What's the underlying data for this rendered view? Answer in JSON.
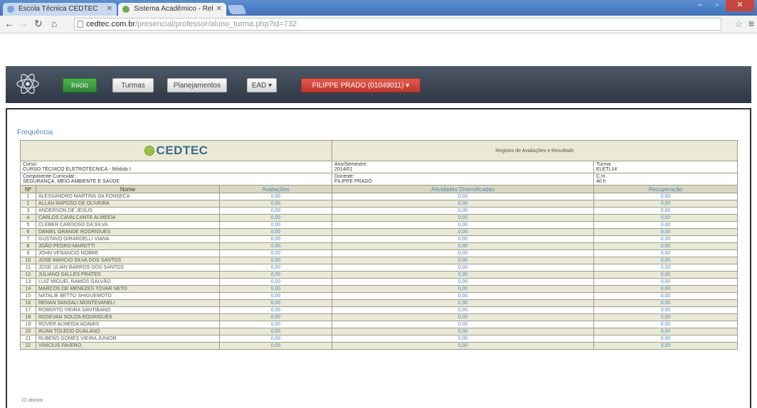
{
  "browser": {
    "tabs": [
      {
        "title": "Escola Técnica CEDTEC"
      },
      {
        "title": "Sistema Acadêmico - Rel"
      }
    ],
    "url_host": "cedtec.com.br",
    "url_path": "/presencial/professor/aluno_turma.php?id=732"
  },
  "nav": {
    "inicio": "Início",
    "turmas": "Turmas",
    "planejamento": "Planejamentos",
    "ead": "EAD ▾",
    "user": "FILIPPE PRADO (01049011) ▾"
  },
  "section_title": "Frequência",
  "report": {
    "logo_text": "CEDTEC",
    "title": "Registro de Avaliações e Resultado",
    "curso_label": "Curso:",
    "curso_value": "CURSO TÉCNICO ELETROTÉCNICA - Módulo I",
    "ano_label": "Ano/Semestre:",
    "ano_value": "2014/01",
    "turma_label": "Turma:",
    "turma_value": "ELETL14",
    "componente_label": "Componente Curricular:",
    "componente_value": "SEGURANÇA, MEIO AMBIENTE E SAÚDE",
    "docente_label": "Docente:",
    "docente_value": "FILIPPE PRADO",
    "ch_label": "C.H.",
    "ch_value": "40 h",
    "columns": [
      "Nº",
      "Nome",
      "Avaliações",
      "Atividades Diversificadas",
      "Recuperação"
    ],
    "students": [
      {
        "n": "1",
        "name": "ALESSANDRO MARTINS DA FONSECA",
        "av": "0,00",
        "ad": "0,00",
        "rec": "0,00"
      },
      {
        "n": "2",
        "name": "ALLAN RAPOSO DE OLIVEIRA",
        "av": "0,00",
        "ad": "0,00",
        "rec": "0,00"
      },
      {
        "n": "3",
        "name": "ANDERSON DE JESUS",
        "av": "0,00",
        "ad": "0,00",
        "rec": "0,00"
      },
      {
        "n": "4",
        "name": "CARLOS CAVALCANTE ALMEIDA",
        "av": "0,00",
        "ad": "0,00",
        "rec": "0,00"
      },
      {
        "n": "5",
        "name": "CLEBER CARDOSO DA SILVA",
        "av": "0,00",
        "ad": "0,00",
        "rec": "0,00"
      },
      {
        "n": "6",
        "name": "DANIEL GRANDE RODRIGUES",
        "av": "0,00",
        "ad": "0,00",
        "rec": "0,00"
      },
      {
        "n": "7",
        "name": "GUSTAVO GIRARDELLI VIANA",
        "av": "0,00",
        "ad": "0,00",
        "rec": "0,00"
      },
      {
        "n": "8",
        "name": "JOÃO PEDRO MAROTTI",
        "av": "0,00",
        "ad": "0,00",
        "rec": "0,00"
      },
      {
        "n": "9",
        "name": "JOHN VENANCIO NOBRE",
        "av": "0,00",
        "ad": "0,00",
        "rec": "0,00"
      },
      {
        "n": "10",
        "name": "JOSE MARCIO SILVA DOS SANTOS",
        "av": "0,00",
        "ad": "0,00",
        "rec": "0,00"
      },
      {
        "n": "11",
        "name": "JOSE ULIAN BARROS DOS SANTOS",
        "av": "0,00",
        "ad": "0,00",
        "rec": "0,00"
      },
      {
        "n": "12",
        "name": "JULIANO SALLES PRATES",
        "av": "0,00",
        "ad": "0,00",
        "rec": "0,00"
      },
      {
        "n": "13",
        "name": "LUIZ MIGUEL RAMOS GALVÃO",
        "av": "0,00",
        "ad": "0,00",
        "rec": "0,00"
      },
      {
        "n": "14",
        "name": "MARCOS DE MENEZES TOVAR NETO",
        "av": "0,00",
        "ad": "0,00",
        "rec": "0,00"
      },
      {
        "n": "15",
        "name": "NATALIE BETTO SHIGUEMOTO",
        "av": "0,00",
        "ad": "0,00",
        "rec": "0,00"
      },
      {
        "n": "16",
        "name": "RENAN SANSALI MONTEVANELI",
        "av": "0,00",
        "ad": "0,00",
        "rec": "0,00"
      },
      {
        "n": "17",
        "name": "ROBERTO VIEIRA SANTIBANO",
        "av": "0,00",
        "ad": "0,00",
        "rec": "0,00"
      },
      {
        "n": "18",
        "name": "ROSEVAN SOUZA RODRIGUES",
        "av": "0,00",
        "ad": "0,00",
        "rec": "0,00"
      },
      {
        "n": "19",
        "name": "ROVER ALMEIDA ADAMIS",
        "av": "0,00",
        "ad": "0,00",
        "rec": "0,00"
      },
      {
        "n": "20",
        "name": "RUAN TOLEDO GUALANO",
        "av": "0,00",
        "ad": "0,00",
        "rec": "0,00"
      },
      {
        "n": "21",
        "name": "RUBENS GOMES VIEIRA JUNIOR",
        "av": "0,00",
        "ad": "0,00",
        "rec": "0,00"
      },
      {
        "n": "22",
        "name": "VINICIUS FAVERO",
        "av": "0,00",
        "ad": "0,00",
        "rec": "0,00"
      }
    ],
    "footer": "22 alunos"
  }
}
